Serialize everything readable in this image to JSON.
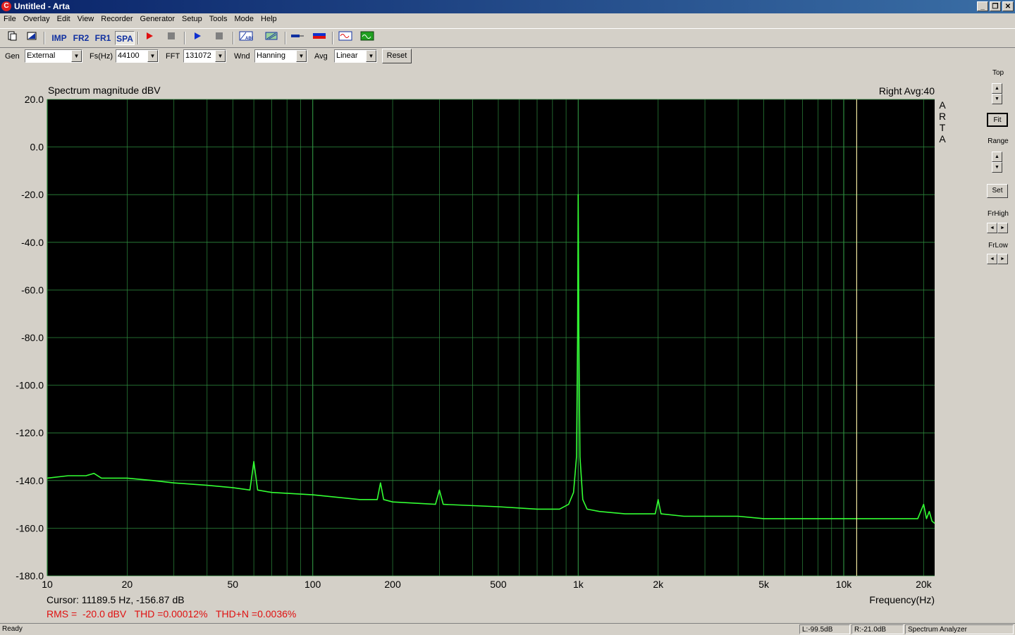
{
  "window": {
    "title": "Untitled - Arta",
    "app_icon_glyph": "C",
    "minimize": "_",
    "restore": "❐",
    "close": "✕"
  },
  "menu": [
    "File",
    "Overlay",
    "Edit",
    "View",
    "Recorder",
    "Generator",
    "Setup",
    "Tools",
    "Mode",
    "Help"
  ],
  "toolbar": {
    "imp": "IMP",
    "fr2": "FR2",
    "fr1": "FR1",
    "spa": "SPA"
  },
  "params": {
    "gen_label": "Gen",
    "gen_value": "External",
    "fs_label": "Fs(Hz)",
    "fs_value": "44100",
    "fft_label": "FFT",
    "fft_value": "131072",
    "wnd_label": "Wnd",
    "wnd_value": "Hanning",
    "avg_label": "Avg",
    "avg_value": "Linear",
    "reset_label": "Reset"
  },
  "right_panel": {
    "top_label": "Top",
    "fit_label": "Fit",
    "range_label": "Range",
    "set_label": "Set",
    "frhigh_label": "FrHigh",
    "frlow_label": "FrLow"
  },
  "plot": {
    "header_left": "Spectrum magnitude dBV",
    "header_right": "Right  Avg:40",
    "watermark": [
      "A",
      "R",
      "T",
      "A"
    ],
    "cursor_text": "Cursor: 11189.5 Hz, -156.87 dB",
    "measurements": "RMS =  -20.0 dBV   THD =0.00012%   THD+N =0.0036%",
    "xlabel": "Frequency(Hz)",
    "background": "#000000",
    "grid_color": "#2e8b3e",
    "trace_color": "#33ff33",
    "cursor_color": "#f0e6a0",
    "measure_color": "#e01010"
  },
  "chart_data": {
    "type": "line",
    "title": "Spectrum magnitude dBV",
    "xlabel": "Frequency(Hz)",
    "ylabel": "",
    "xscale": "log",
    "xlim": [
      10,
      22000
    ],
    "ylim": [
      -180,
      20
    ],
    "grid": true,
    "x_ticks": [
      {
        "value": 10,
        "label": "10"
      },
      {
        "value": 20,
        "label": "20"
      },
      {
        "value": 50,
        "label": "50"
      },
      {
        "value": 100,
        "label": "100"
      },
      {
        "value": 200,
        "label": "200"
      },
      {
        "value": 500,
        "label": "500"
      },
      {
        "value": 1000,
        "label": "1k"
      },
      {
        "value": 2000,
        "label": "2k"
      },
      {
        "value": 5000,
        "label": "5k"
      },
      {
        "value": 10000,
        "label": "10k"
      },
      {
        "value": 20000,
        "label": "20k"
      }
    ],
    "y_ticks": [
      {
        "value": 20,
        "label": "20.0"
      },
      {
        "value": 0,
        "label": "0.0"
      },
      {
        "value": -20,
        "label": "-20.0"
      },
      {
        "value": -40,
        "label": "-40.0"
      },
      {
        "value": -60,
        "label": "-60.0"
      },
      {
        "value": -80,
        "label": "-80.0"
      },
      {
        "value": -100,
        "label": "-100.0"
      },
      {
        "value": -120,
        "label": "-120.0"
      },
      {
        "value": -140,
        "label": "-140.0"
      },
      {
        "value": -160,
        "label": "-160.0"
      },
      {
        "value": -180,
        "label": "-180.0"
      }
    ],
    "cursor_hz": 11189.5,
    "series": [
      {
        "x": [
          10,
          12,
          14,
          15,
          16,
          17,
          20,
          25,
          30,
          40,
          50,
          58,
          60,
          62,
          70,
          100,
          150,
          175,
          180,
          185,
          200,
          290,
          300,
          310,
          500,
          700,
          850,
          920,
          960,
          985,
          995,
          1000,
          1005,
          1015,
          1040,
          1080,
          1200,
          1500,
          1950,
          2000,
          2050,
          2500,
          3000,
          4000,
          5000,
          6000,
          7000,
          8000,
          9000,
          10000,
          12000,
          14000,
          16000,
          18000,
          19000,
          20000,
          20500,
          21000,
          21500,
          22000
        ],
        "y": [
          -139,
          -138,
          -138,
          -137,
          -139,
          -139,
          -139,
          -140,
          -141,
          -142,
          -143,
          -144,
          -132,
          -144,
          -145,
          -146,
          -148,
          -148,
          -141,
          -148,
          -149,
          -150,
          -144,
          -150,
          -151,
          -152,
          -152,
          -150,
          -145,
          -130,
          -78,
          -20,
          -78,
          -130,
          -148,
          -152,
          -153,
          -154,
          -154,
          -148,
          -154,
          -155,
          -155,
          -155,
          -156,
          -156,
          -156,
          -156,
          -156,
          -156,
          -156,
          -156,
          -156,
          -156,
          -156,
          -150,
          -156,
          -153,
          -157,
          -158
        ]
      }
    ]
  },
  "status": {
    "left": "Ready",
    "l_level": "L:-99.5dB",
    "r_level": "R:-21.0dB",
    "mode": "Spectrum Analyzer"
  }
}
